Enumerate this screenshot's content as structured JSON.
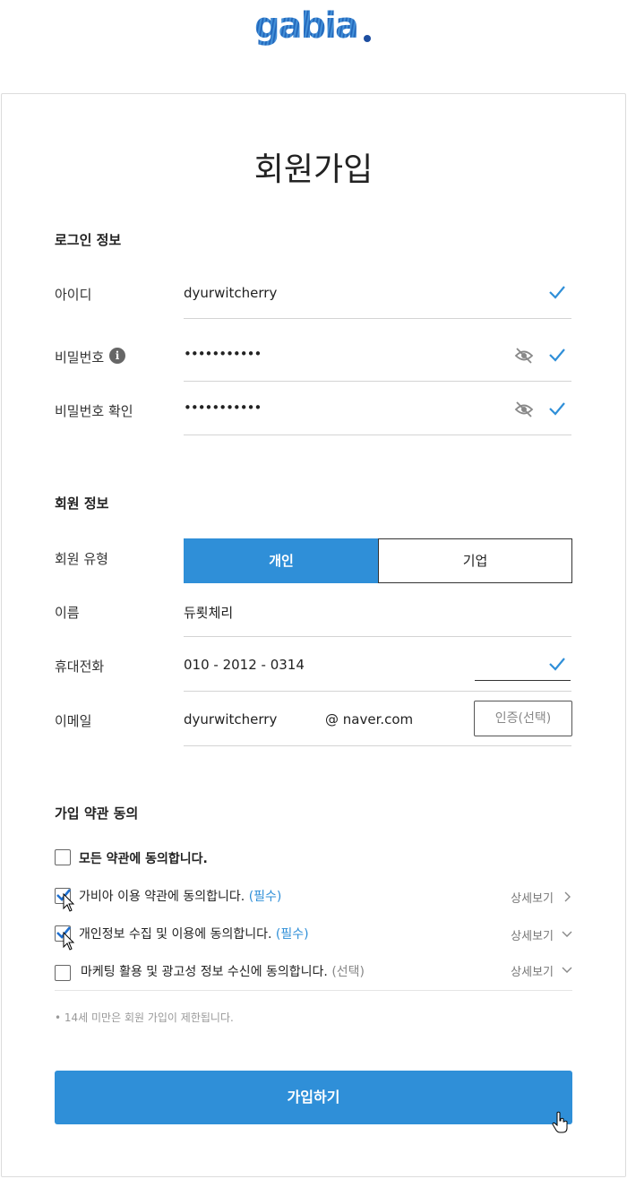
{
  "brand": {
    "logo_text": "gabia",
    "accent": "#2f8fd8"
  },
  "page": {
    "title": "회원가입"
  },
  "login_section": {
    "title": "로그인 정보",
    "id": {
      "label": "아이디",
      "value": "dyurwitcherry"
    },
    "password": {
      "label": "비밀번호",
      "value": "•••••••••••"
    },
    "password_confirm": {
      "label": "비밀번호 확인",
      "value": "•••••••••••"
    }
  },
  "member_section": {
    "title": "회원 정보",
    "type": {
      "label": "회원 유형",
      "options": [
        "개인",
        "기업"
      ],
      "selected": "개인"
    },
    "name": {
      "label": "이름",
      "value": "듀룃체리"
    },
    "phone": {
      "label": "휴대전화",
      "value": "010 - 2012 - 0314"
    },
    "email": {
      "label": "이메일",
      "local": "dyurwitcherry",
      "domain": "@ naver.com",
      "verify_label": "인증(선택)"
    }
  },
  "terms_section": {
    "title": "가입 약관 동의",
    "all": {
      "label": "모든 약관에 동의합니다.",
      "checked": false
    },
    "items": [
      {
        "label": "가비아 이용 약관에 동의합니다.",
        "tag": "(필수)",
        "detail": "상세보기",
        "checked": true
      },
      {
        "label": "개인정보 수집 및 이용에 동의합니다.",
        "tag": "(필수)",
        "detail": "상세보기",
        "checked": true
      },
      {
        "label": "마케팅 활용 및 광고성 정보 수신에 동의합니다.",
        "tag": "(선택)",
        "detail": "상세보기",
        "checked": false
      }
    ],
    "note": "• 14세 미만은 회원 가입이 제한됩니다."
  },
  "submit": {
    "label": "가입하기"
  }
}
